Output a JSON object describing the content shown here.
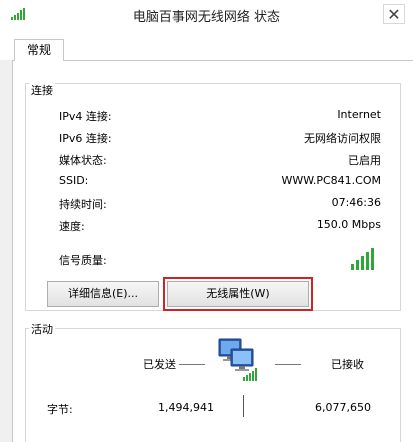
{
  "window": {
    "title": "电脑百事网无线网络 状态",
    "close_glyph": "✕"
  },
  "tabs": [
    {
      "label": "常规",
      "selected": true
    }
  ],
  "connection": {
    "section_title": "连接",
    "rows": [
      {
        "label": "IPv4 连接:",
        "value": "Internet"
      },
      {
        "label": "IPv6 连接:",
        "value": "无网络访问权限"
      },
      {
        "label": "媒体状态:",
        "value": "已启用"
      },
      {
        "label": "SSID:",
        "value": "WWW.PC841.COM"
      },
      {
        "label": "持续时间:",
        "value": "07:46:36"
      },
      {
        "label": "速度:",
        "value": "150.0 Mbps"
      }
    ],
    "signal": {
      "label": "信号质量:",
      "bars_total": 5,
      "bars_lit": 5,
      "color": "#2fa838"
    }
  },
  "buttons": {
    "details": "详细信息(E)...",
    "wireless_properties": "无线属性(W)"
  },
  "highlight_color": "#d32222",
  "activity": {
    "section_title": "活动",
    "sent_label": "已发送",
    "received_label": "已接收",
    "bytes_label": "字节:",
    "bytes_sent": "1,494,941",
    "bytes_received": "6,077,650"
  },
  "icons": {
    "title": "wifi-signal-icon",
    "network": "network-computers-icon"
  }
}
